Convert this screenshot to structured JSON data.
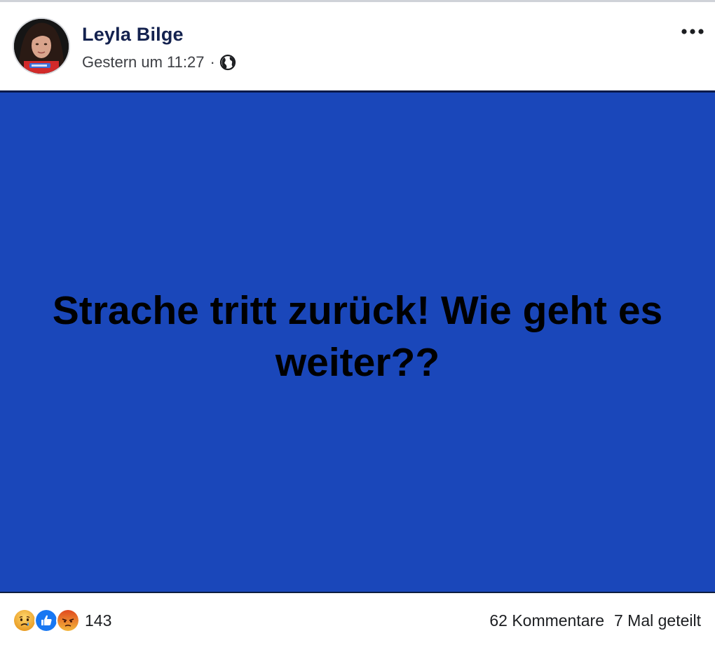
{
  "post": {
    "author_name": "Leyla Bilge",
    "timestamp": "Gestern um 11:27",
    "separator": "·",
    "privacy_icon": "globe-icon",
    "more_icon": "more-dots-icon",
    "image": {
      "background_color": "#1a47ba",
      "text": "Strache tritt zurück! Wie geht es weiter??"
    }
  },
  "stats": {
    "reactions": [
      "sad-reaction-icon",
      "like-reaction-icon",
      "angry-reaction-icon"
    ],
    "reaction_count": "143",
    "comments": "62 Kommentare",
    "shares": "7 Mal geteilt"
  },
  "colors": {
    "author_name": "#14224f",
    "like_blue": "#1877f2",
    "angry_red": "#e0491f",
    "sad_yellow": "#f5b83d"
  }
}
